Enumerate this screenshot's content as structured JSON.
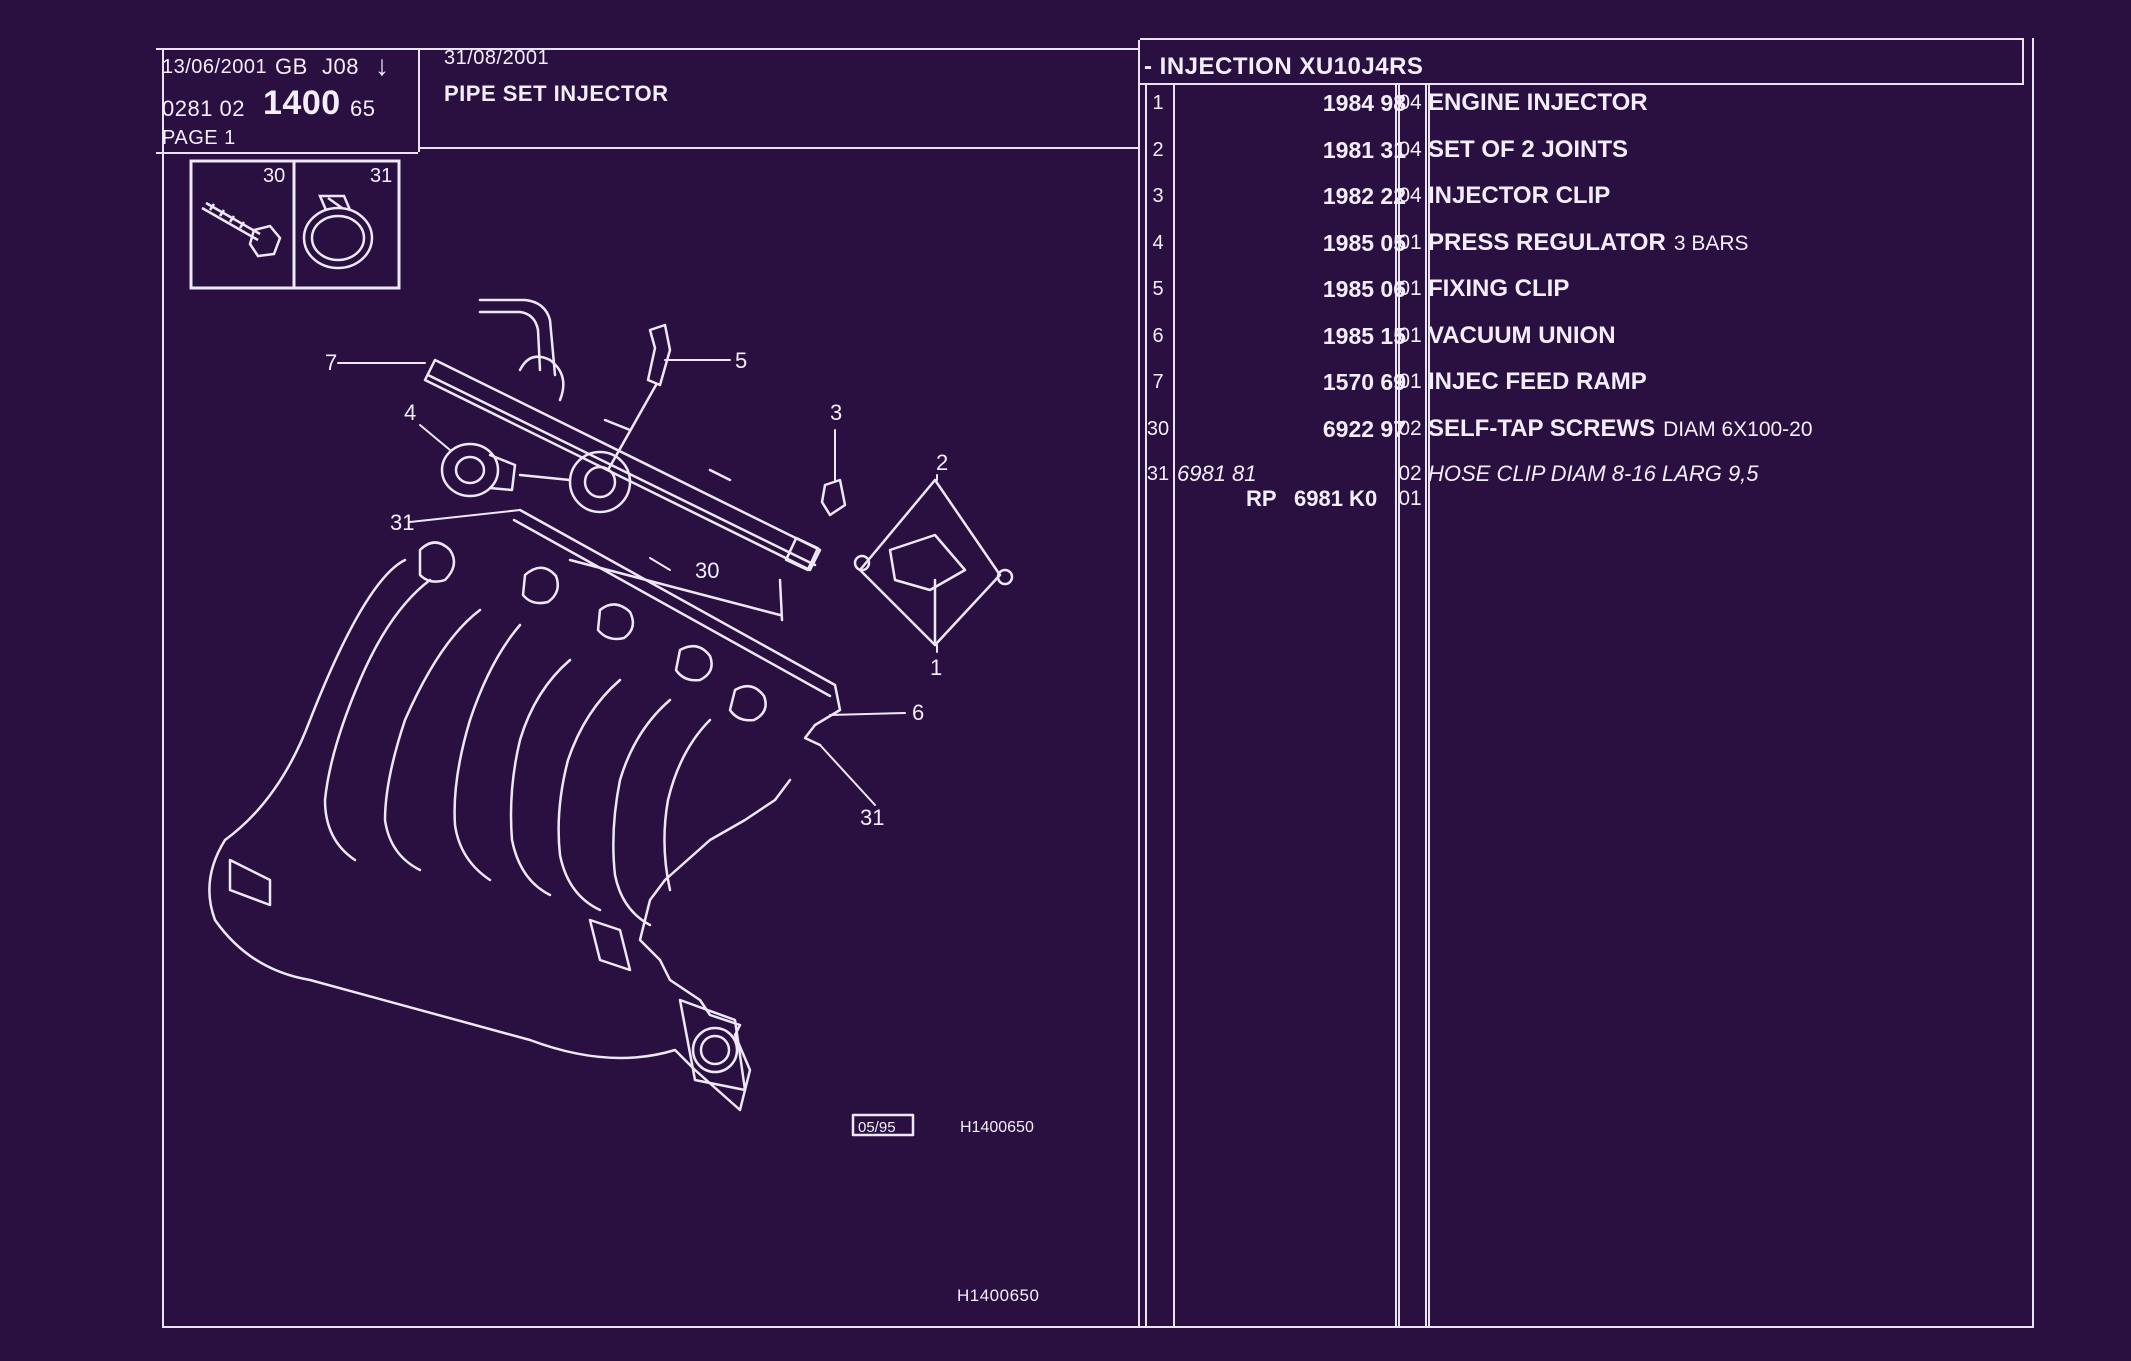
{
  "header": {
    "print_date": "13/06/2001",
    "lang": "GB",
    "code": "J08",
    "arrow": "↓",
    "ref_prefix": "0281 02",
    "ref_main": "1400",
    "ref_suffix": "65",
    "page": "PAGE 1",
    "issue_date": "31/08/2001",
    "title": "PIPE SET INJECTOR"
  },
  "section_title": "- INJECTION XU10J4RS",
  "inset": {
    "left_number": "30",
    "right_number": "31"
  },
  "diagram": {
    "callouts": [
      "7",
      "5",
      "4",
      "3",
      "2",
      "31",
      "30",
      "6",
      "1",
      "31"
    ],
    "date_box": "05/95",
    "code": "H1400650",
    "footer_code": "H1400650"
  },
  "parts": [
    {
      "num": "1",
      "ref": "1984 98",
      "qty": "04",
      "desc": "ENGINE INJECTOR",
      "extra": ""
    },
    {
      "num": "2",
      "ref": "1981 31",
      "qty": "04",
      "desc": "SET OF 2 JOINTS",
      "extra": ""
    },
    {
      "num": "3",
      "ref": "1982 22",
      "qty": "04",
      "desc": "INJECTOR CLIP",
      "extra": ""
    },
    {
      "num": "4",
      "ref": "1985 05",
      "qty": "01",
      "desc": "PRESS REGULATOR",
      "extra": "3 BARS"
    },
    {
      "num": "5",
      "ref": "1985 06",
      "qty": "01",
      "desc": "FIXING CLIP",
      "extra": ""
    },
    {
      "num": "6",
      "ref": "1985 15",
      "qty": "01",
      "desc": "VACUUM UNION",
      "extra": ""
    },
    {
      "num": "7",
      "ref": "1570 69",
      "qty": "01",
      "desc": "INJEC FEED RAMP",
      "extra": ""
    },
    {
      "num": "30",
      "ref": "6922 97",
      "qty": "02",
      "desc": "SELF-TAP SCREWS",
      "extra": "DIAM 6X100-20"
    }
  ],
  "part31": {
    "num": "31",
    "ref": "6981 81",
    "qty": "02",
    "desc": "HOSE CLIP DIAM 8-16 LARG 9,5",
    "rp_label": "RP",
    "rp_ref": "6981 K0",
    "rp_qty": "01"
  }
}
